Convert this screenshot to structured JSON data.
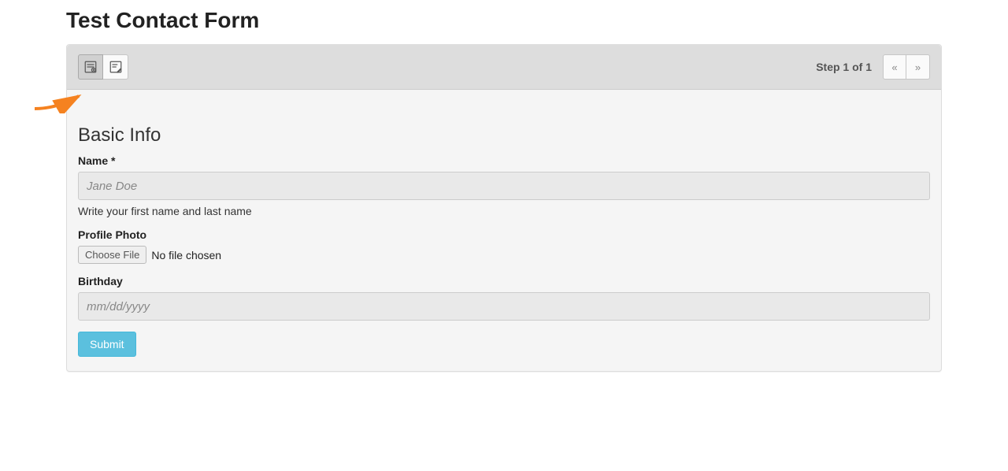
{
  "page_title": "Test Contact Form",
  "toolbar": {
    "step_text": "Step 1 of 1"
  },
  "icons": {
    "view_icon": "form-view-icon",
    "edit_icon": "form-edit-icon"
  },
  "section": {
    "title": "Basic Info"
  },
  "fields": {
    "name": {
      "label": "Name *",
      "placeholder": "Jane Doe",
      "help": "Write your first name and last name"
    },
    "photo": {
      "label": "Profile Photo",
      "button": "Choose File",
      "status": "No file chosen"
    },
    "birthday": {
      "label": "Birthday",
      "placeholder": "mm/dd/yyyy"
    }
  },
  "submit_label": "Submit"
}
